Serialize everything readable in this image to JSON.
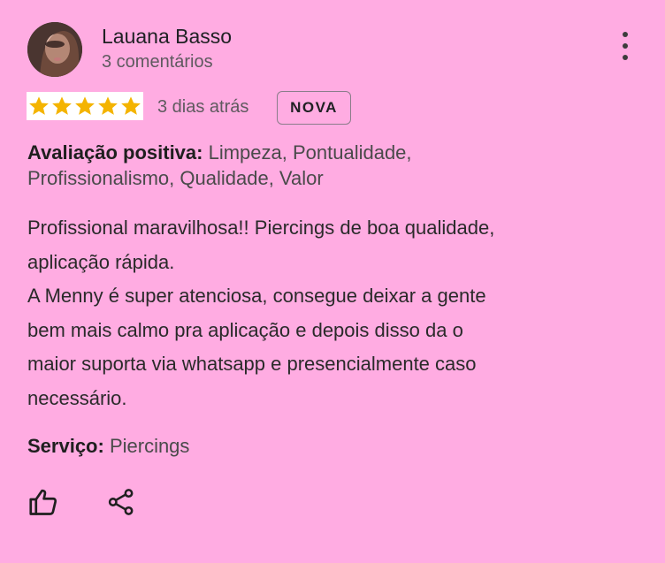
{
  "review": {
    "author": "Lauana Basso",
    "comment_count": "3 comentários",
    "rating": 5,
    "date": "3 dias atrás",
    "badge": "NOVA",
    "positive_label": "Avaliação positiva:",
    "positive_line1": " Limpeza, Pontualidade,",
    "positive_line2": " Profissionalismo, Qualidade, Valor",
    "text": "Profissional maravilhosa!! Piercings de boa qualidade,\naplicação rápida.\nA Menny é super atenciosa, consegue deixar a gente\nbem mais calmo pra aplicação e depois disso da o\nmaior suporta via whatsapp e presencialmente caso\nnecessário.",
    "service_label": "Serviço:",
    "service_value": " Piercings"
  },
  "icons": {
    "avatar": "user-avatar",
    "more": "more-vert-icon",
    "star": "star-icon",
    "like": "thumbs-up-icon",
    "share": "share-icon"
  },
  "colors": {
    "background": "#FFACE2",
    "star": "#F4B400",
    "text": "#1f1f1f",
    "secondary": "#5f5a5f"
  }
}
